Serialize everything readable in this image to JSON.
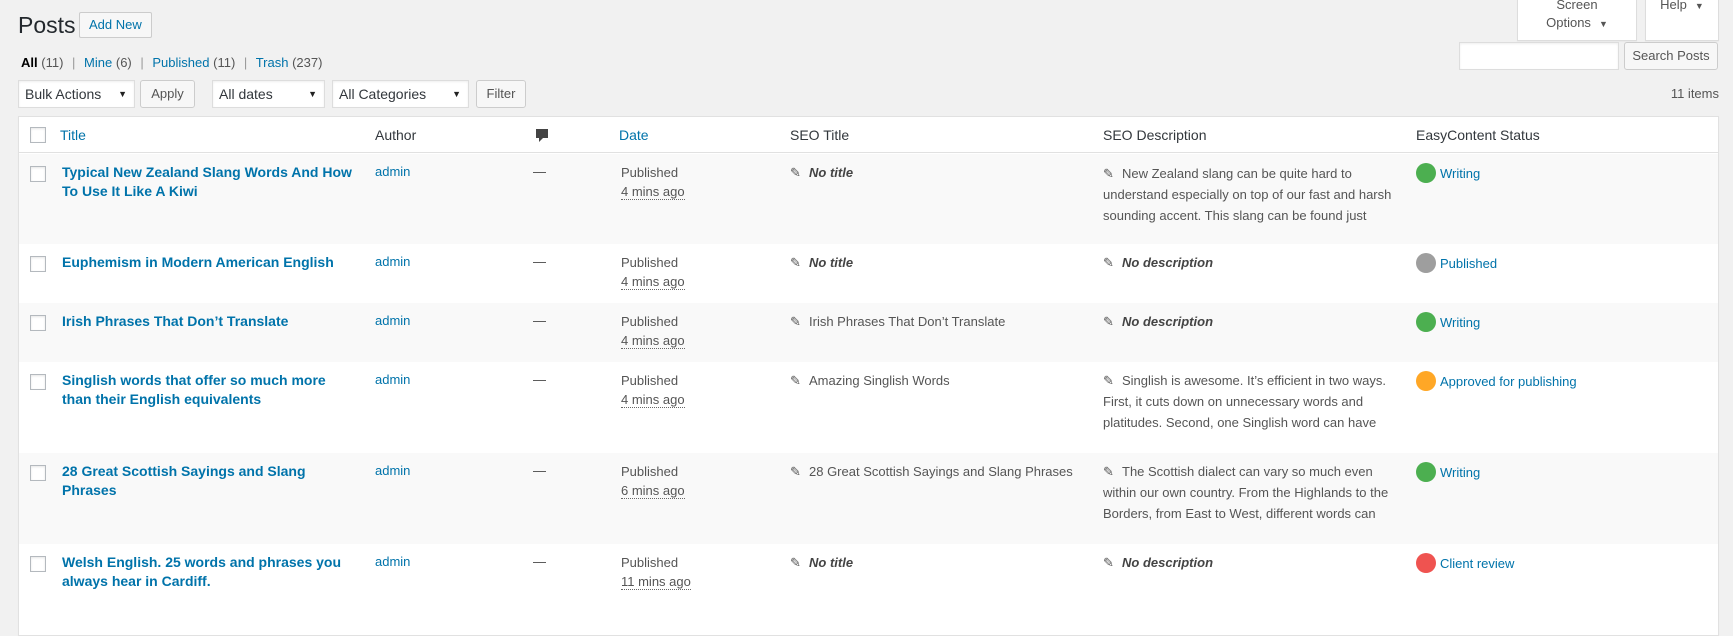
{
  "header": {
    "title": "Posts",
    "add_new": "Add New",
    "screen_options": "Screen Options",
    "help": "Help"
  },
  "views": [
    {
      "label": "All",
      "count": "(11)"
    },
    {
      "label": "Mine",
      "count": "(6)"
    },
    {
      "label": "Published",
      "count": "(11)"
    },
    {
      "label": "Trash",
      "count": "(237)"
    }
  ],
  "search": {
    "value": "",
    "button": "Search Posts"
  },
  "filters": {
    "bulk_actions": "Bulk Actions",
    "apply": "Apply",
    "dates": "All dates",
    "categories": "All Categories",
    "filter": "Filter",
    "items_count": "11 items"
  },
  "columns": {
    "title": "Title",
    "author": "Author",
    "comments_icon": "comment-icon",
    "date": "Date",
    "seo_title": "SEO Title",
    "seo_description": "SEO Description",
    "easycontent_status": "EasyContent Status"
  },
  "status_colors": {
    "Writing": "#4caf50",
    "Published": "#9e9e9e",
    "Approved for publishing": "#ffa726",
    "Client review": "#ef5350"
  },
  "rows": [
    {
      "title": "Typical New Zealand Slang Words And How To Use It Like A Kiwi",
      "author": "admin",
      "comments": "—",
      "date_status": "Published",
      "date_ago": "4 mins ago",
      "seo_title": "No title",
      "seo_description": "New Zealand slang can be quite hard to understand especially on top of our fast and harsh sounding accent.  This slang can be found just about anywhere, even in the likes of fancy",
      "status": "Writing"
    },
    {
      "title": "Euphemism in Modern American English",
      "author": "admin",
      "comments": "—",
      "date_status": "Published",
      "date_ago": "4 mins ago",
      "seo_title": "No title",
      "seo_description": "No description",
      "status": "Published"
    },
    {
      "title": "Irish Phrases That Don’t Translate",
      "author": "admin",
      "comments": "—",
      "date_status": "Published",
      "date_ago": "4 mins ago",
      "seo_title": "Irish Phrases That Don’t Translate",
      "seo_description": "No description",
      "status": "Writing"
    },
    {
      "title": "Singlish words that offer so much more than their English equivalents",
      "author": "admin",
      "comments": "—",
      "date_status": "Published",
      "date_ago": "4 mins ago",
      "seo_title": "Amazing Singlish Words",
      "seo_description": "Singlish is awesome. It’s efficient in two ways. First, it cuts down on unnecessary words and platitudes. Second, one Singlish word can have multiple meanings and it takes a full sentence in",
      "status": "Approved for publishing"
    },
    {
      "title": "28 Great Scottish Sayings and Slang Phrases",
      "author": "admin",
      "comments": "—",
      "date_status": "Published",
      "date_ago": "6 mins ago",
      "seo_title": "28 Great Scottish Sayings and Slang Phrases",
      "seo_description": "The Scottish dialect can vary so much even within our own country. From the Highlands to the Borders, from East to West, different words can mean the same thing.",
      "status": "Writing"
    },
    {
      "title": "Welsh English. 25 words and phrases you always hear in Cardiff.",
      "author": "admin",
      "comments": "—",
      "date_status": "Published",
      "date_ago": "11 mins ago",
      "seo_title": "No title",
      "seo_description": "No description",
      "status": "Client review"
    }
  ]
}
